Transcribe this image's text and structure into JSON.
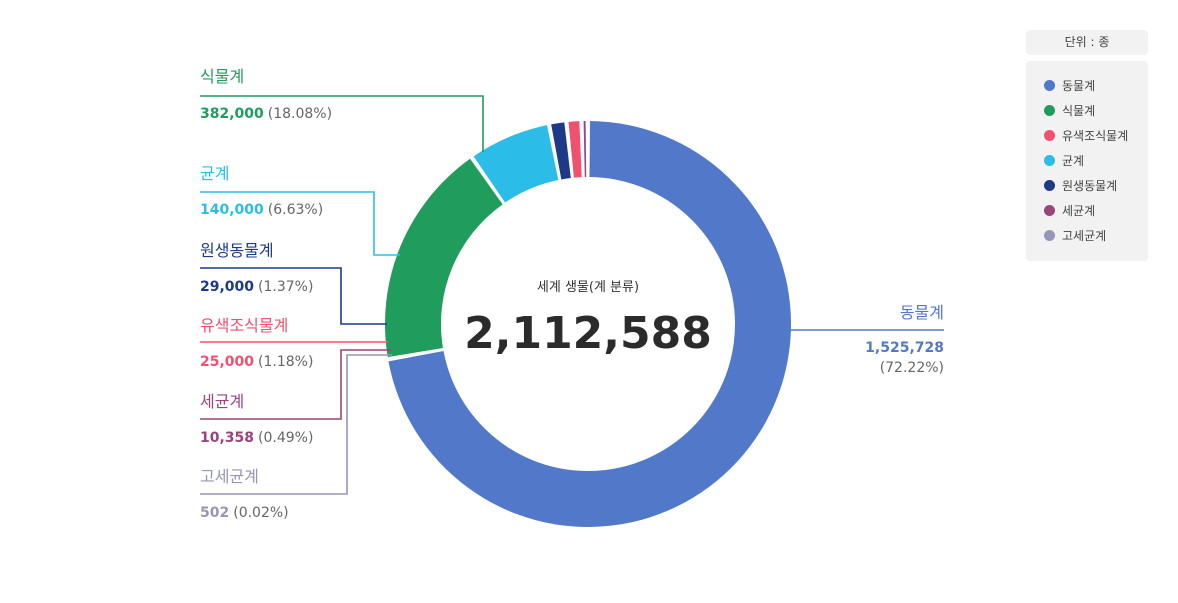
{
  "unit_label": "단위 : 종",
  "chart_data": {
    "type": "pie",
    "style": "donut",
    "center_label": "세계 생물(계 분류)",
    "total": "2,112,588",
    "legend_position": "right",
    "categories": [
      {
        "name": "동물계",
        "value": 1525728,
        "value_label": "1,525,728",
        "percent_label": "(72.22%)",
        "color": "#5279c9"
      },
      {
        "name": "식물계",
        "value": 382000,
        "value_label": "382,000",
        "percent_label": "(18.08%)",
        "color": "#209c5c"
      },
      {
        "name": "균계",
        "value": 140000,
        "value_label": "140,000",
        "percent_label": "(6.63%)",
        "color": "#2bbde8"
      },
      {
        "name": "원생동물계",
        "value": 29000,
        "value_label": "29,000",
        "percent_label": "(1.37%)",
        "color": "#1d3a86"
      },
      {
        "name": "유색조식물계",
        "value": 25000,
        "value_label": "25,000",
        "percent_label": "(1.18%)",
        "color": "#f2506f"
      },
      {
        "name": "세균계",
        "value": 10358,
        "value_label": "10,358",
        "percent_label": "(0.49%)",
        "color": "#9b4479"
      },
      {
        "name": "고세균계",
        "value": 502,
        "value_label": "502",
        "percent_label": "(0.02%)",
        "color": "#9696b6"
      }
    ],
    "legend_order": [
      "동물계",
      "식물계",
      "유색조식물계",
      "균계",
      "원생동물계",
      "세균계",
      "고세균계"
    ]
  }
}
